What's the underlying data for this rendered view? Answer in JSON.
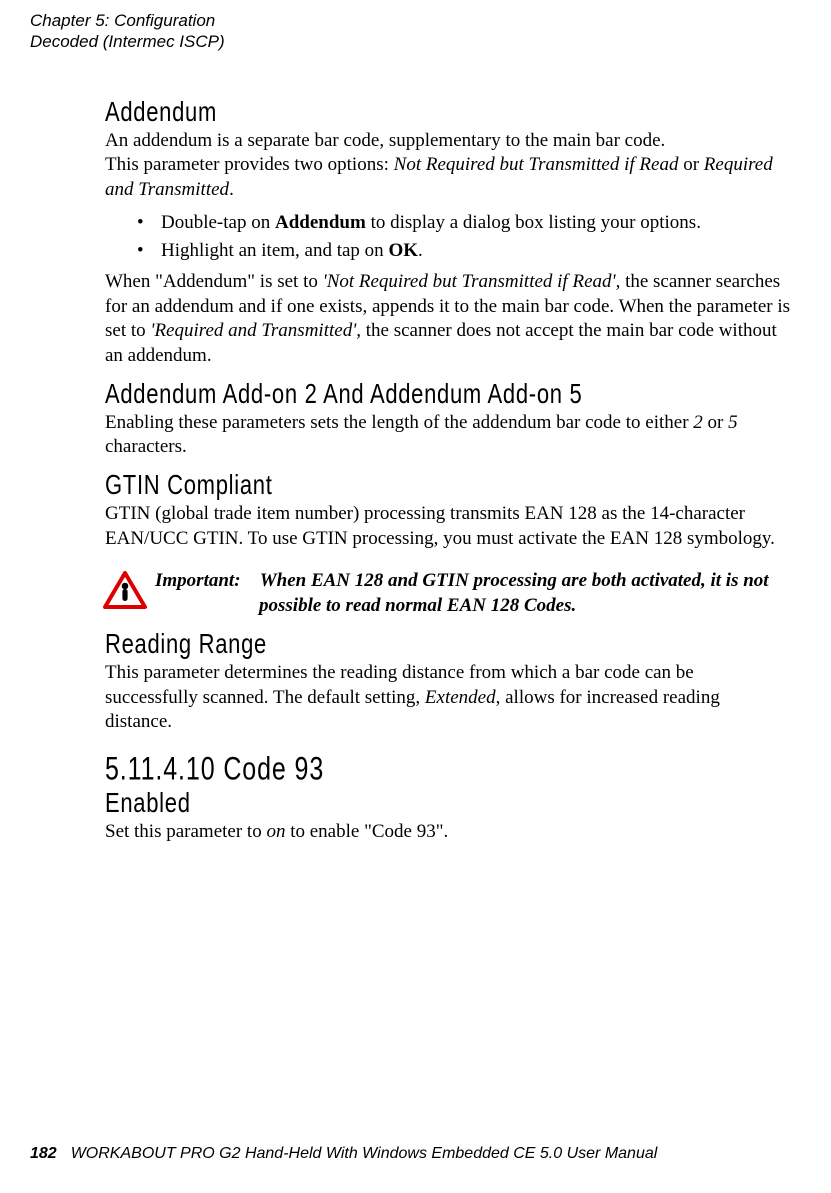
{
  "header": {
    "chapter_line1": "Chapter 5: Configuration",
    "chapter_line2": "Decoded (Intermec ISCP)"
  },
  "addendum": {
    "title": "Addendum",
    "p1_a": "An addendum is a separate bar code, supplementary to the main bar code.",
    "p1_b": "This parameter provides two options: ",
    "opt1": "Not Required but Transmitted if Read",
    "or": " or ",
    "opt2": "Required and Transmitted",
    "period": ".",
    "bullet1_a": "Double-tap on ",
    "bullet1_b": "Addendum",
    "bullet1_c": " to display a dialog box listing your options.",
    "bullet2_a": "Highlight an item, and tap on ",
    "bullet2_b": "OK",
    "bullet2_c": ".",
    "p2_a": "When \"Addendum\" is set to ",
    "p2_b": "'Not Required but Transmitted if Read',",
    "p2_c": " the scanner searches for an addendum and if one exists, appends it to the main bar code. When the parameter is set to ",
    "p2_d": "'Required and Transmitted',",
    "p2_e": " the scanner does not accept the main bar code without an addendum."
  },
  "addon": {
    "title": "Addendum Add-on 2 And Addendum Add-on 5",
    "p_a": "Enabling these parameters sets the length of the addendum bar code to either ",
    "two": "2",
    "p_b": " or ",
    "five": "5",
    "p_c": " characters."
  },
  "gtin": {
    "title": "GTIN Compliant",
    "p": "GTIN (global trade item number) processing transmits EAN 128 as the 14-character EAN/UCC GTIN. To use GTIN processing, you must activate the EAN 128 symbology."
  },
  "important": {
    "label": "Important:",
    "body_line1": "When EAN 128 and GTIN processing are both activated, it is not",
    "body_line2": "possible to read normal EAN 128 Codes."
  },
  "reading_range": {
    "title": "Reading Range",
    "p_a": "This parameter determines the reading distance from which a bar code can be successfully scanned. The default setting, ",
    "ext": "Extended",
    "p_b": ", allows for increased reading distance."
  },
  "code93": {
    "title": "5.11.4.10 Code 93",
    "enabled_title": "Enabled",
    "p_a": "Set this parameter to ",
    "on": "on",
    "p_b": " to enable \"Code 93\"."
  },
  "footer": {
    "page_num": "182",
    "doc_title": "WORKABOUT PRO G2 Hand-Held With Windows Embedded CE 5.0 User Manual"
  }
}
